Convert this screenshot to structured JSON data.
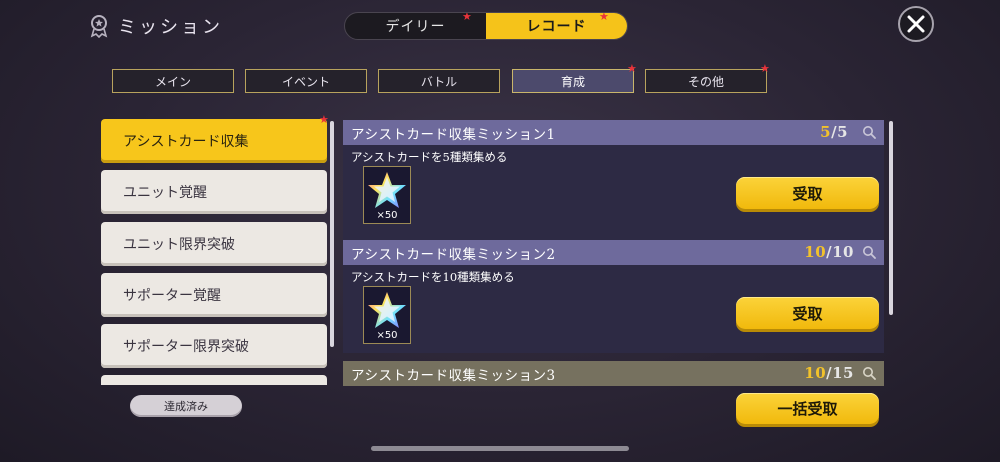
{
  "header": {
    "title": "ミッション",
    "title_icon": "medal-icon",
    "segment": [
      {
        "label": "デイリー",
        "active": false,
        "notify": true
      },
      {
        "label": "レコード",
        "active": true,
        "notify": true
      }
    ],
    "close_icon": "close-icon"
  },
  "tabs": [
    {
      "label": "メイン",
      "active": false,
      "notify": false
    },
    {
      "label": "イベント",
      "active": false,
      "notify": false
    },
    {
      "label": "バトル",
      "active": false,
      "notify": false
    },
    {
      "label": "育成",
      "active": true,
      "notify": true
    },
    {
      "label": "その他",
      "active": false,
      "notify": true
    }
  ],
  "categories": [
    {
      "label": "アシストカード収集",
      "active": true,
      "notify": true
    },
    {
      "label": "ユニット覚醒",
      "active": false
    },
    {
      "label": "ユニット限界突破",
      "active": false
    },
    {
      "label": "サポーター覚醒",
      "active": false
    },
    {
      "label": "サポーター限界突破",
      "active": false
    }
  ],
  "completed_button": "達成済み",
  "missions": [
    {
      "title": "アシストカード収集ミッション1",
      "current": "5",
      "total": "5",
      "description": "アシストカードを5種類集める",
      "reward_qty": "×50",
      "claim_label": "受取"
    },
    {
      "title": "アシストカード収集ミッション2",
      "current": "10",
      "total": "10",
      "description": "アシストカードを10種類集める",
      "reward_qty": "×50",
      "claim_label": "受取"
    },
    {
      "title": "アシストカード収集ミッション3",
      "current": "10",
      "total": "15"
    }
  ],
  "bulk_claim_label": "一括受取",
  "colors": {
    "accent": "#f5c31a",
    "notify": "#e8333a",
    "card_header": "#6e6a9c",
    "card_body": "#2d2a44"
  }
}
